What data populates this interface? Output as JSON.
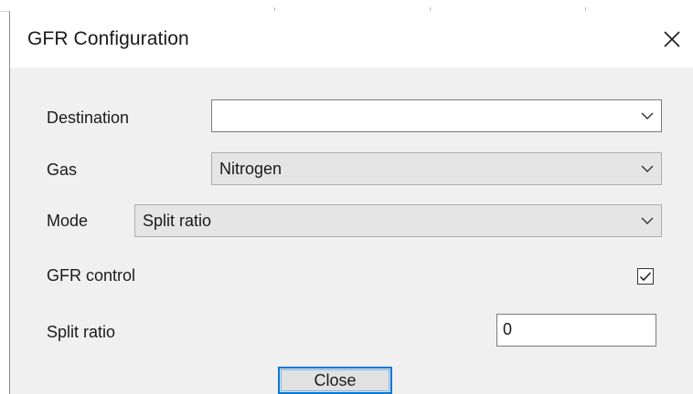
{
  "window": {
    "title": "GFR Configuration"
  },
  "icons": {
    "close": "close-icon",
    "dropdown": "chevron-down-icon",
    "check": "checkmark-icon"
  },
  "form": {
    "destination": {
      "label": "Destination",
      "value": ""
    },
    "gas": {
      "label": "Gas",
      "value": "Nitrogen"
    },
    "mode": {
      "label": "Mode",
      "value": "Split ratio"
    },
    "gfr_control": {
      "label": "GFR control",
      "checked": true
    },
    "split_ratio": {
      "label": "Split ratio",
      "value": "0"
    }
  },
  "buttons": {
    "close_label": "Close"
  },
  "colors": {
    "client_background": "#f0f0f0",
    "focus_border": "#0078d7",
    "readonly_combo": "#e5e5e5"
  }
}
